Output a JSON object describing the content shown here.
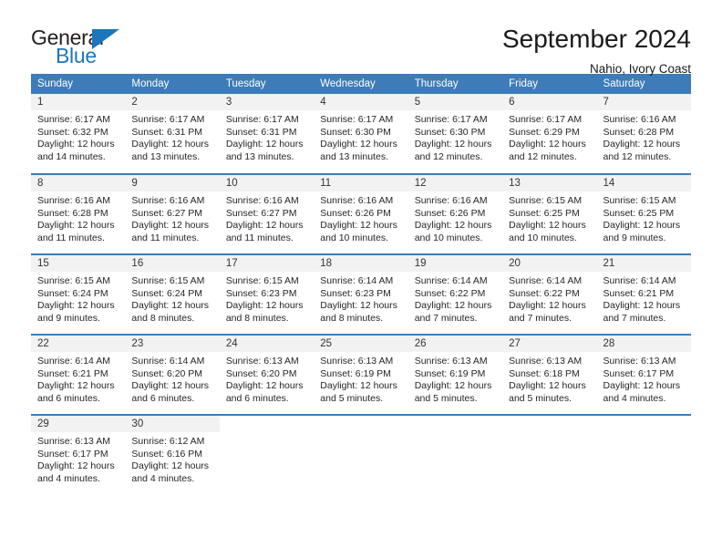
{
  "brand": {
    "name_part1": "General",
    "name_part2": "Blue",
    "triangle_icon": "triangle-icon",
    "accent_color": "#1b76bc"
  },
  "header": {
    "title": "September 2024",
    "location": "Nahio, Ivory Coast"
  },
  "theme": {
    "header_blue": "#3d7cb8",
    "daynum_band": "#f2f2f2",
    "text": "#262626"
  },
  "weekdays": [
    "Sunday",
    "Monday",
    "Tuesday",
    "Wednesday",
    "Thursday",
    "Friday",
    "Saturday"
  ],
  "weeks": [
    [
      {
        "day": "1",
        "sunrise": "Sunrise: 6:17 AM",
        "sunset": "Sunset: 6:32 PM",
        "daylight_line1": "Daylight: 12 hours",
        "daylight_line2": "and 14 minutes."
      },
      {
        "day": "2",
        "sunrise": "Sunrise: 6:17 AM",
        "sunset": "Sunset: 6:31 PM",
        "daylight_line1": "Daylight: 12 hours",
        "daylight_line2": "and 13 minutes."
      },
      {
        "day": "3",
        "sunrise": "Sunrise: 6:17 AM",
        "sunset": "Sunset: 6:31 PM",
        "daylight_line1": "Daylight: 12 hours",
        "daylight_line2": "and 13 minutes."
      },
      {
        "day": "4",
        "sunrise": "Sunrise: 6:17 AM",
        "sunset": "Sunset: 6:30 PM",
        "daylight_line1": "Daylight: 12 hours",
        "daylight_line2": "and 13 minutes."
      },
      {
        "day": "5",
        "sunrise": "Sunrise: 6:17 AM",
        "sunset": "Sunset: 6:30 PM",
        "daylight_line1": "Daylight: 12 hours",
        "daylight_line2": "and 12 minutes."
      },
      {
        "day": "6",
        "sunrise": "Sunrise: 6:17 AM",
        "sunset": "Sunset: 6:29 PM",
        "daylight_line1": "Daylight: 12 hours",
        "daylight_line2": "and 12 minutes."
      },
      {
        "day": "7",
        "sunrise": "Sunrise: 6:16 AM",
        "sunset": "Sunset: 6:28 PM",
        "daylight_line1": "Daylight: 12 hours",
        "daylight_line2": "and 12 minutes."
      }
    ],
    [
      {
        "day": "8",
        "sunrise": "Sunrise: 6:16 AM",
        "sunset": "Sunset: 6:28 PM",
        "daylight_line1": "Daylight: 12 hours",
        "daylight_line2": "and 11 minutes."
      },
      {
        "day": "9",
        "sunrise": "Sunrise: 6:16 AM",
        "sunset": "Sunset: 6:27 PM",
        "daylight_line1": "Daylight: 12 hours",
        "daylight_line2": "and 11 minutes."
      },
      {
        "day": "10",
        "sunrise": "Sunrise: 6:16 AM",
        "sunset": "Sunset: 6:27 PM",
        "daylight_line1": "Daylight: 12 hours",
        "daylight_line2": "and 11 minutes."
      },
      {
        "day": "11",
        "sunrise": "Sunrise: 6:16 AM",
        "sunset": "Sunset: 6:26 PM",
        "daylight_line1": "Daylight: 12 hours",
        "daylight_line2": "and 10 minutes."
      },
      {
        "day": "12",
        "sunrise": "Sunrise: 6:16 AM",
        "sunset": "Sunset: 6:26 PM",
        "daylight_line1": "Daylight: 12 hours",
        "daylight_line2": "and 10 minutes."
      },
      {
        "day": "13",
        "sunrise": "Sunrise: 6:15 AM",
        "sunset": "Sunset: 6:25 PM",
        "daylight_line1": "Daylight: 12 hours",
        "daylight_line2": "and 10 minutes."
      },
      {
        "day": "14",
        "sunrise": "Sunrise: 6:15 AM",
        "sunset": "Sunset: 6:25 PM",
        "daylight_line1": "Daylight: 12 hours",
        "daylight_line2": "and 9 minutes."
      }
    ],
    [
      {
        "day": "15",
        "sunrise": "Sunrise: 6:15 AM",
        "sunset": "Sunset: 6:24 PM",
        "daylight_line1": "Daylight: 12 hours",
        "daylight_line2": "and 9 minutes."
      },
      {
        "day": "16",
        "sunrise": "Sunrise: 6:15 AM",
        "sunset": "Sunset: 6:24 PM",
        "daylight_line1": "Daylight: 12 hours",
        "daylight_line2": "and 8 minutes."
      },
      {
        "day": "17",
        "sunrise": "Sunrise: 6:15 AM",
        "sunset": "Sunset: 6:23 PM",
        "daylight_line1": "Daylight: 12 hours",
        "daylight_line2": "and 8 minutes."
      },
      {
        "day": "18",
        "sunrise": "Sunrise: 6:14 AM",
        "sunset": "Sunset: 6:23 PM",
        "daylight_line1": "Daylight: 12 hours",
        "daylight_line2": "and 8 minutes."
      },
      {
        "day": "19",
        "sunrise": "Sunrise: 6:14 AM",
        "sunset": "Sunset: 6:22 PM",
        "daylight_line1": "Daylight: 12 hours",
        "daylight_line2": "and 7 minutes."
      },
      {
        "day": "20",
        "sunrise": "Sunrise: 6:14 AM",
        "sunset": "Sunset: 6:22 PM",
        "daylight_line1": "Daylight: 12 hours",
        "daylight_line2": "and 7 minutes."
      },
      {
        "day": "21",
        "sunrise": "Sunrise: 6:14 AM",
        "sunset": "Sunset: 6:21 PM",
        "daylight_line1": "Daylight: 12 hours",
        "daylight_line2": "and 7 minutes."
      }
    ],
    [
      {
        "day": "22",
        "sunrise": "Sunrise: 6:14 AM",
        "sunset": "Sunset: 6:21 PM",
        "daylight_line1": "Daylight: 12 hours",
        "daylight_line2": "and 6 minutes."
      },
      {
        "day": "23",
        "sunrise": "Sunrise: 6:14 AM",
        "sunset": "Sunset: 6:20 PM",
        "daylight_line1": "Daylight: 12 hours",
        "daylight_line2": "and 6 minutes."
      },
      {
        "day": "24",
        "sunrise": "Sunrise: 6:13 AM",
        "sunset": "Sunset: 6:20 PM",
        "daylight_line1": "Daylight: 12 hours",
        "daylight_line2": "and 6 minutes."
      },
      {
        "day": "25",
        "sunrise": "Sunrise: 6:13 AM",
        "sunset": "Sunset: 6:19 PM",
        "daylight_line1": "Daylight: 12 hours",
        "daylight_line2": "and 5 minutes."
      },
      {
        "day": "26",
        "sunrise": "Sunrise: 6:13 AM",
        "sunset": "Sunset: 6:19 PM",
        "daylight_line1": "Daylight: 12 hours",
        "daylight_line2": "and 5 minutes."
      },
      {
        "day": "27",
        "sunrise": "Sunrise: 6:13 AM",
        "sunset": "Sunset: 6:18 PM",
        "daylight_line1": "Daylight: 12 hours",
        "daylight_line2": "and 5 minutes."
      },
      {
        "day": "28",
        "sunrise": "Sunrise: 6:13 AM",
        "sunset": "Sunset: 6:17 PM",
        "daylight_line1": "Daylight: 12 hours",
        "daylight_line2": "and 4 minutes."
      }
    ],
    [
      {
        "day": "29",
        "sunrise": "Sunrise: 6:13 AM",
        "sunset": "Sunset: 6:17 PM",
        "daylight_line1": "Daylight: 12 hours",
        "daylight_line2": "and 4 minutes."
      },
      {
        "day": "30",
        "sunrise": "Sunrise: 6:12 AM",
        "sunset": "Sunset: 6:16 PM",
        "daylight_line1": "Daylight: 12 hours",
        "daylight_line2": "and 4 minutes."
      },
      {
        "day": "",
        "sunrise": "",
        "sunset": "",
        "daylight_line1": "",
        "daylight_line2": ""
      },
      {
        "day": "",
        "sunrise": "",
        "sunset": "",
        "daylight_line1": "",
        "daylight_line2": ""
      },
      {
        "day": "",
        "sunrise": "",
        "sunset": "",
        "daylight_line1": "",
        "daylight_line2": ""
      },
      {
        "day": "",
        "sunrise": "",
        "sunset": "",
        "daylight_line1": "",
        "daylight_line2": ""
      },
      {
        "day": "",
        "sunrise": "",
        "sunset": "",
        "daylight_line1": "",
        "daylight_line2": ""
      }
    ]
  ]
}
